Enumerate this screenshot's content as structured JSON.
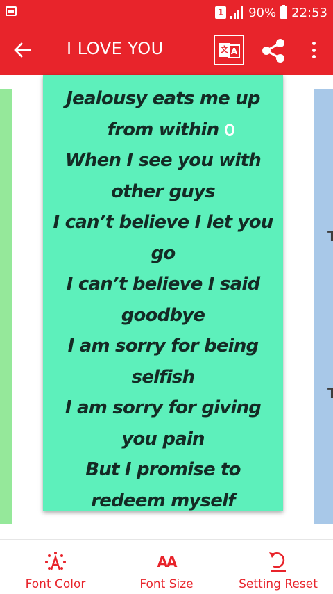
{
  "status_bar": {
    "sim_label": "1",
    "battery_percent": "90%",
    "time": "22:53",
    "icons": [
      "gallery-icon",
      "signal-icon",
      "battery-icon"
    ]
  },
  "toolbar": {
    "title": "I LOVE YOU",
    "translate_from": "文",
    "translate_to": "A",
    "icons": [
      "back-arrow-icon",
      "translate-icon",
      "share-icon",
      "more-vert-icon"
    ]
  },
  "poem": {
    "lines": [
      "Jealousy eats me up",
      "from within",
      "When I see you with",
      "other guys",
      "I can’t believe I let you",
      "go",
      "I can’t believe I said",
      "goodbye",
      "I am sorry for being",
      "selfish",
      "I am sorry for giving",
      "you pain",
      "But I promise to",
      "redeem myself"
    ]
  },
  "cards": {
    "center_color": "#5df0bb",
    "left_color": "#95e89a",
    "right_color": "#a8c8e8"
  },
  "bottom_bar": {
    "font_color_label": "Font Color",
    "font_size_label": "Font Size",
    "font_size_icon_text": "AA",
    "setting_reset_label": "Setting Reset"
  },
  "colors": {
    "accent": "#e8242b",
    "text_dark": "#142b25"
  }
}
